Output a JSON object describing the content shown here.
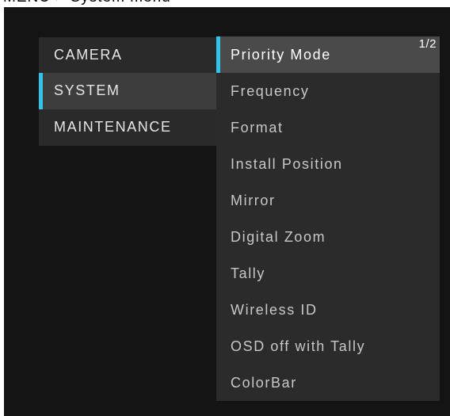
{
  "header": {
    "caption": "MENU > System menu"
  },
  "left_menu": {
    "items": [
      {
        "label": "CAMERA",
        "selected": false
      },
      {
        "label": "SYSTEM",
        "selected": true
      },
      {
        "label": "MAINTENANCE",
        "selected": false
      }
    ]
  },
  "right_menu": {
    "page_indicator": "1/2",
    "items": [
      {
        "label": "Priority Mode",
        "selected": true
      },
      {
        "label": "Frequency",
        "selected": false
      },
      {
        "label": "Format",
        "selected": false
      },
      {
        "label": "Install Position",
        "selected": false
      },
      {
        "label": "Mirror",
        "selected": false
      },
      {
        "label": "Digital Zoom",
        "selected": false
      },
      {
        "label": "Tally",
        "selected": false
      },
      {
        "label": "Wireless ID",
        "selected": false
      },
      {
        "label": "OSD off with Tally",
        "selected": false
      },
      {
        "label": "ColorBar",
        "selected": false
      }
    ]
  },
  "colors": {
    "background": "#141414",
    "panel": "#2a2a2a",
    "selected": "#4a4a4a",
    "accent": "#2fc4e8",
    "text": "#e6e6e6"
  }
}
